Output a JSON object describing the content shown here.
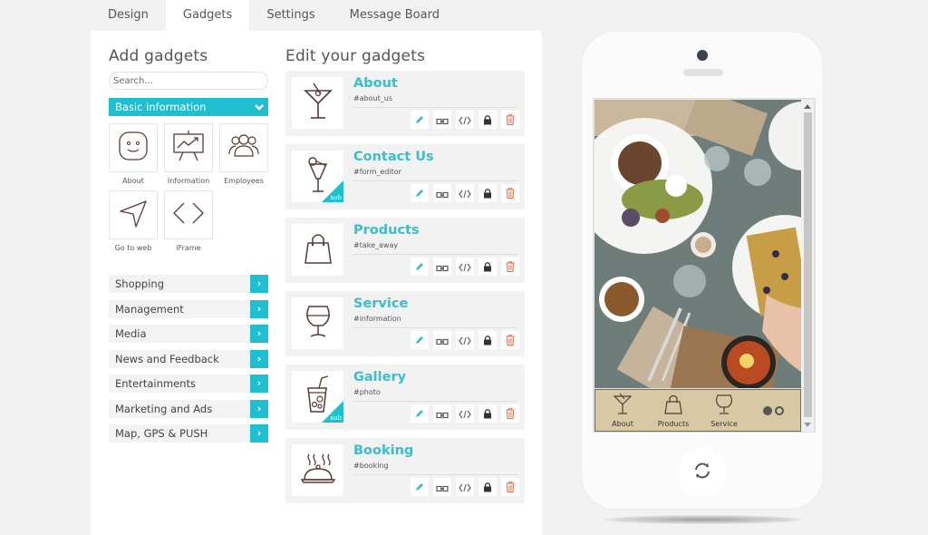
{
  "tabs": [
    {
      "label": "Design",
      "active": false
    },
    {
      "label": "Gadgets",
      "active": true
    },
    {
      "label": "Settings",
      "active": false
    },
    {
      "label": "Message Board",
      "active": false
    }
  ],
  "add_gadgets": {
    "title": "Add gadgets",
    "search_placeholder": "Search...",
    "open_category": "Basic information",
    "gadgets": [
      {
        "label": "About",
        "icon": "smiley-face-icon"
      },
      {
        "label": "Information",
        "icon": "presentation-chart-icon"
      },
      {
        "label": "Employees",
        "icon": "people-group-icon"
      },
      {
        "label": "Go to web",
        "icon": "navigation-arrow-icon"
      },
      {
        "label": "iFrame",
        "icon": "code-brackets-icon"
      }
    ],
    "categories": [
      "Shopping",
      "Management",
      "Media",
      "News and Feedback",
      "Entertainments",
      "Marketing and Ads",
      "Map, GPS & PUSH"
    ]
  },
  "edit_gadgets": {
    "title": "Edit your gadgets",
    "sub_badge": "sub",
    "items": [
      {
        "title": "About",
        "tag": "#about_us",
        "icon": "martini-glass-icon",
        "sub": false
      },
      {
        "title": "Contact Us",
        "tag": "#form_editor",
        "icon": "cocktail-glass-icon",
        "sub": true
      },
      {
        "title": "Products",
        "tag": "#take_away",
        "icon": "shopping-bag-icon",
        "sub": false
      },
      {
        "title": "Service",
        "tag": "#information",
        "icon": "brandy-glass-icon",
        "sub": false
      },
      {
        "title": "Gallery",
        "tag": "#photo",
        "icon": "iced-drink-icon",
        "sub": true
      },
      {
        "title": "Booking",
        "tag": "#booking",
        "icon": "food-cloche-icon",
        "sub": false
      }
    ],
    "actions": [
      "edit-pencil-icon",
      "link-icon",
      "code-icon",
      "lock-icon",
      "trash-icon"
    ]
  },
  "phone_preview": {
    "nav": [
      {
        "label": "About",
        "icon": "martini-glass-icon"
      },
      {
        "label": "Products",
        "icon": "shopping-bag-icon"
      },
      {
        "label": "Service",
        "icon": "brandy-glass-icon"
      }
    ],
    "page_dots": {
      "count": 2,
      "active": 1
    },
    "home_button_icon": "refresh-icon"
  },
  "colors": {
    "accent": "#1fbfcf",
    "title_accent": "#3cbccc",
    "nav_bar": "#d8c8a4",
    "icon_brown": "#5a3a36",
    "trash": "#e0704f"
  }
}
